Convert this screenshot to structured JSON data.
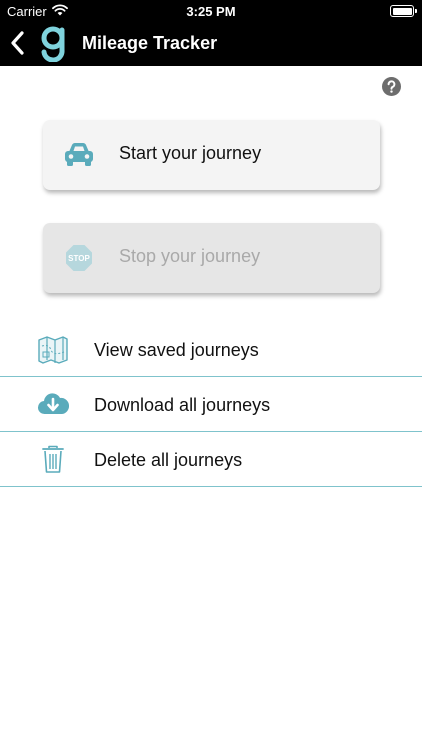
{
  "status_bar": {
    "carrier": "Carrier",
    "time": "3:25 PM"
  },
  "nav": {
    "title": "Mileage Tracker",
    "logo_letter": "g"
  },
  "actions": {
    "start": {
      "label": "Start your journey",
      "icon": "car-icon"
    },
    "stop": {
      "label": "Stop your journey",
      "icon": "stop-sign-icon",
      "disabled": true
    }
  },
  "menu": [
    {
      "label": "View saved journeys",
      "icon": "map-icon"
    },
    {
      "label": "Download all journeys",
      "icon": "cloud-download-icon"
    },
    {
      "label": "Delete all journeys",
      "icon": "trash-icon"
    }
  ],
  "colors": {
    "accent": "#5aabbb",
    "divider": "#7fc3cc",
    "bar": "#000000",
    "disabled_text": "#a9a9a9"
  }
}
